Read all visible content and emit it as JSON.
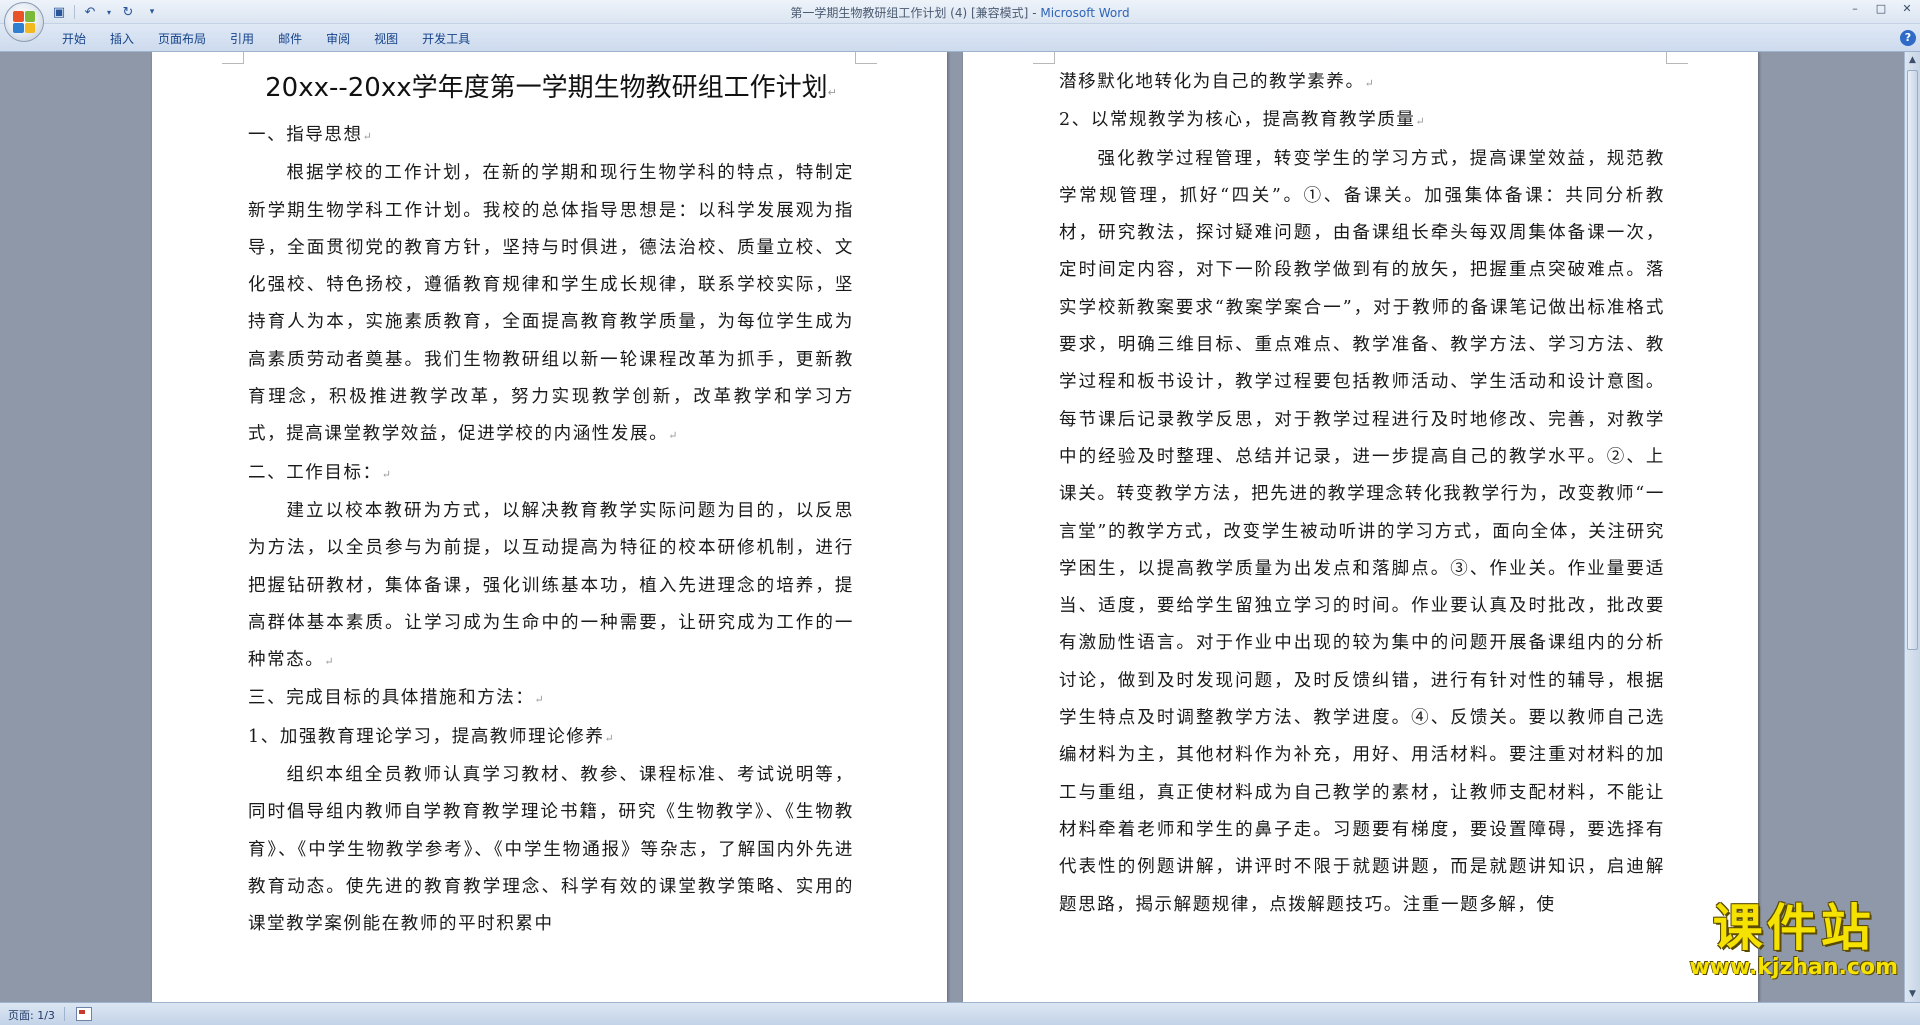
{
  "window": {
    "title": "第一学期生物教研组工作计划 (4) [兼容模式]",
    "app_name": "Microsoft Word",
    "controls": [
      "–",
      "□",
      "✕"
    ]
  },
  "quick_access": {
    "save_icon": "save-icon",
    "undo_icon": "undo-icon",
    "redo_icon": "redo-icon",
    "customize_icon": "customize-icon"
  },
  "ribbon": {
    "tabs": [
      "开始",
      "插入",
      "页面布局",
      "引用",
      "邮件",
      "审阅",
      "视图",
      "开发工具"
    ],
    "help": "?"
  },
  "page1": {
    "title": "20xx--20xx学年度第一学期生物教研组工作计划",
    "paragraphs": [
      "一、指导思想",
      "根据学校的工作计划，在新的学期和现行生物学科的特点，特制定新学期生物学科工作计划。我校的总体指导思想是：以科学发展观为指导，全面贯彻党的教育方针，坚持与时俱进，德法治校、质量立校、文化强校、特色扬校，遵循教育规律和学生成长规律，联系学校实际，坚持育人为本，实施素质教育，全面提高教育教学质量，为每位学生成为高素质劳动者奠基。我们生物教研组以新一轮课程改革为抓手，更新教育理念，积极推进教学改革，努力实现教学创新，改革教学和学习方式，提高课堂教学效益，促进学校的内涵性发展。",
      "二、工作目标：",
      "建立以校本教研为方式，以解决教育教学实际问题为目的，以反思为方法，以全员参与为前提，以互动提高为特征的校本研修机制，进行把握钻研教材，集体备课，强化训练基本功，植入先进理念的培养，提高群体基本素质。让学习成为生命中的一种需要，让研究成为工作的一种常态。",
      "三、完成目标的具体措施和方法：",
      "1、加强教育理论学习，提高教师理论修养",
      "组织本组全员教师认真学习教材、教参、课程标准、考试说明等，同时倡导组内教师自学教育教学理论书籍，研究《生物教学》、《生物教育》、《中学生物教学参考》、《中学生物通报》等杂志，了解国内外先进教育动态。使先进的教育教学理念、科学有效的课堂教学策略、实用的课堂教学案例能在教师的平时积累中"
    ]
  },
  "page2": {
    "paragraphs": [
      "潜移默化地转化为自己的教学素养。",
      "2、以常规教学为核心，提高教育教学质量",
      "强化教学过程管理，转变学生的学习方式，提高课堂效益，规范教学常规管理，抓好“四关”。①、备课关。加强集体备课：共同分析教材，研究教法，探讨疑难问题，由备课组长牵头每双周集体备课一次，定时间定内容，对下一阶段教学做到有的放矢，把握重点突破难点。落实学校新教案要求“教案学案合一”，对于教师的备课笔记做出标准格式要求，明确三维目标、重点难点、教学准备、教学方法、学习方法、教学过程和板书设计，教学过程要包括教师活动、学生活动和设计意图。每节课后记录教学反思，对于教学过程进行及时地修改、完善，对教学中的经验及时整理、总结并记录，进一步提高自己的教学水平。②、上课关。转变教学方法，把先进的教学理念转化我教学行为，改变教师“一言堂”的教学方式，改变学生被动听讲的学习方式，面向全体，关注研究学困生，以提高教学质量为出发点和落脚点。③、作业关。作业量要适当、适度，要给学生留独立学习的时间。作业要认真及时批改，批改要有激励性语言。对于作业中出现的较为集中的问题开展备课组内的分析讨论，做到及时发现问题，及时反馈纠错，进行有针对性的辅导，根据学生特点及时调整教学方法、教学进度。④、反馈关。要以教师自己选编材料为主，其他材料作为补充，用好、用活材料。要注重对材料的加工与重组，真正使材料成为自己教学的素材，让教师支配材料，不能让材料牵着老师和学生的鼻子走。习题要有梯度，要设置障碍，要选择有代表性的例题讲解，讲评时不限于就题讲题，而是就题讲知识，启迪解题思路，揭示解题规律，点拨解题技巧。注重一题多解，使"
    ]
  },
  "watermark": {
    "title": "课件站",
    "url": "www.kjzhan.com"
  },
  "status": {
    "page": "页面: 1/3"
  }
}
